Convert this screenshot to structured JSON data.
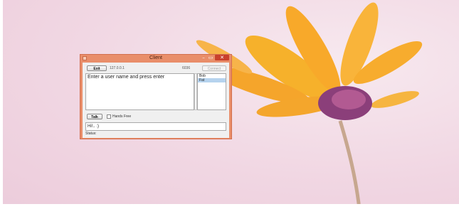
{
  "window": {
    "title": "Client",
    "controls": {
      "minimize": "–",
      "maximize": "▭",
      "close": "✕"
    }
  },
  "toolbar": {
    "exit_label": "Exit",
    "ip_value": "127.0.0.1",
    "port_value": "6036",
    "connect_label": "Connect"
  },
  "chat": {
    "messages": "Enter a user name and press enter"
  },
  "users": {
    "items": [
      "Bob",
      "Fat"
    ],
    "selected": "Fat"
  },
  "controls": {
    "talk_label": "Talk",
    "hands_free_label": "Hands Free"
  },
  "input": {
    "value": "Hi!.. :)"
  },
  "status": {
    "label": "Status:"
  }
}
